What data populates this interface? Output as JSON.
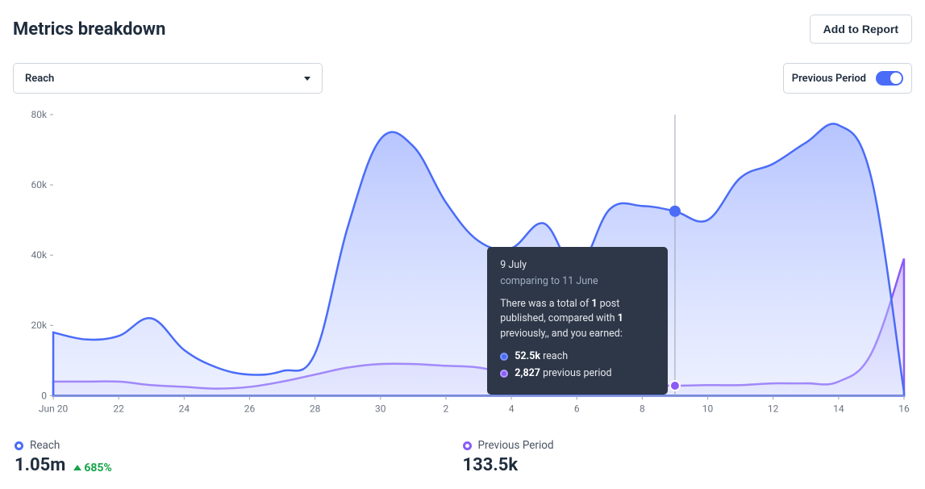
{
  "header": {
    "title": "Metrics breakdown",
    "add_to_report": "Add to Report"
  },
  "controls": {
    "metric_selected": "Reach",
    "toggle_label": "Previous Period"
  },
  "tooltip": {
    "date": "9 July",
    "compare": "comparing to 11 June",
    "body_pre": "There was a total of ",
    "body_posts_current": "1",
    "body_mid": " post published, compared with ",
    "body_posts_prev": "1",
    "body_post": " previously,, and you earned:",
    "reach_val": "52.5k",
    "reach_label": " reach",
    "prev_val": "2,827",
    "prev_label": " previous period"
  },
  "legend": {
    "reach_label": "Reach",
    "reach_value": "1.05m",
    "reach_delta": "685%",
    "prev_label": "Previous Period",
    "prev_value": "133.5k"
  },
  "chart_data": {
    "type": "area",
    "xlabel": "",
    "ylabel": "",
    "ylim": [
      0,
      80000
    ],
    "y_ticks": [
      0,
      20000,
      40000,
      60000,
      80000
    ],
    "y_tick_labels": [
      "0",
      "20k",
      "40k",
      "60k",
      "80k"
    ],
    "x_tick_labels": [
      "Jun 20",
      "22",
      "24",
      "26",
      "28",
      "30",
      "2",
      "4",
      "6",
      "8",
      "10",
      "12",
      "14",
      "16"
    ],
    "categories": [
      "Jun 20",
      "Jun 21",
      "Jun 22",
      "Jun 23",
      "Jun 24",
      "Jun 25",
      "Jun 26",
      "Jun 27",
      "Jun 28",
      "Jun 29",
      "Jun 30",
      "Jul 1",
      "Jul 2",
      "Jul 3",
      "Jul 4",
      "Jul 5",
      "Jul 6",
      "Jul 7",
      "Jul 8",
      "Jul 9",
      "Jul 10",
      "Jul 11",
      "Jul 12",
      "Jul 13",
      "Jul 14",
      "Jul 15",
      "Jul 16"
    ],
    "series": [
      {
        "name": "Reach",
        "color": "#4a6cf7",
        "values": [
          18000,
          16000,
          17000,
          22000,
          13000,
          8000,
          6000,
          7000,
          12000,
          48000,
          73000,
          71000,
          55000,
          44000,
          42000,
          49000,
          36000,
          53000,
          54000,
          52500,
          50000,
          62000,
          66000,
          72000,
          77000,
          62000,
          1000
        ]
      },
      {
        "name": "Previous Period",
        "color": "#8b5cf6",
        "values": [
          4000,
          4000,
          4000,
          3000,
          2500,
          2000,
          2500,
          4000,
          6000,
          8000,
          9000,
          9000,
          8500,
          8000,
          6000,
          4000,
          3500,
          3500,
          3000,
          2827,
          3000,
          3000,
          3500,
          3500,
          4000,
          12000,
          39000
        ]
      }
    ],
    "cursor": {
      "category": "Jul 9",
      "reach": 52500,
      "prev": 2827
    }
  }
}
